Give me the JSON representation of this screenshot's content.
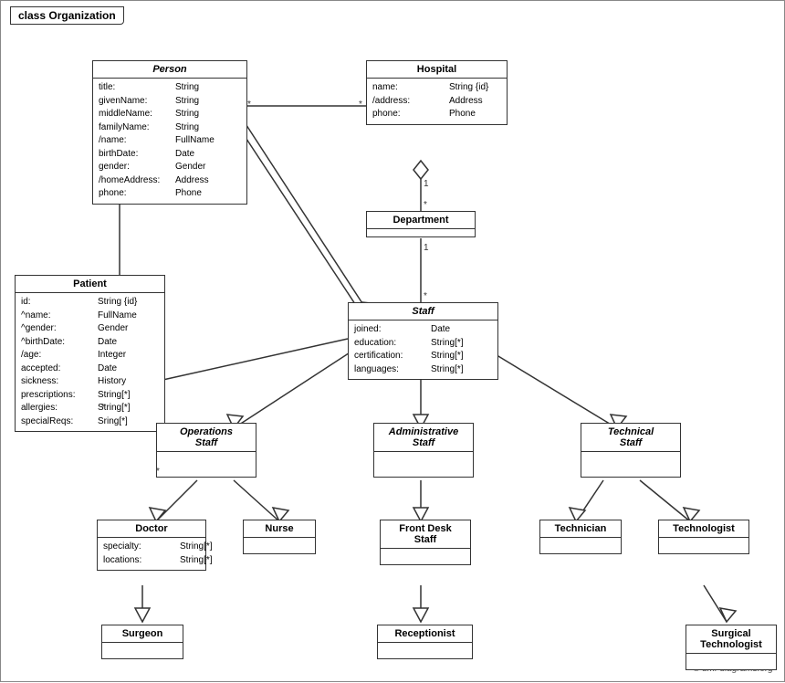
{
  "diagram": {
    "title": "class Organization",
    "copyright": "© uml-diagrams.org",
    "classes": {
      "person": {
        "name": "Person",
        "italic": true,
        "attrs": [
          {
            "name": "title:",
            "type": "String"
          },
          {
            "name": "givenName:",
            "type": "String"
          },
          {
            "name": "middleName:",
            "type": "String"
          },
          {
            "name": "familyName:",
            "type": "String"
          },
          {
            "name": "/name:",
            "type": "FullName"
          },
          {
            "name": "birthDate:",
            "type": "Date"
          },
          {
            "name": "gender:",
            "type": "Gender"
          },
          {
            "name": "/homeAddress:",
            "type": "Address"
          },
          {
            "name": "phone:",
            "type": "Phone"
          }
        ]
      },
      "hospital": {
        "name": "Hospital",
        "italic": false,
        "attrs": [
          {
            "name": "name:",
            "type": "String {id}"
          },
          {
            "name": "/address:",
            "type": "Address"
          },
          {
            "name": "phone:",
            "type": "Phone"
          }
        ]
      },
      "patient": {
        "name": "Patient",
        "italic": false,
        "attrs": [
          {
            "name": "id:",
            "type": "String {id}"
          },
          {
            "name": "^name:",
            "type": "FullName"
          },
          {
            "name": "^gender:",
            "type": "Gender"
          },
          {
            "name": "^birthDate:",
            "type": "Date"
          },
          {
            "name": "/age:",
            "type": "Integer"
          },
          {
            "name": "accepted:",
            "type": "Date"
          },
          {
            "name": "sickness:",
            "type": "History"
          },
          {
            "name": "prescriptions:",
            "type": "String[*]"
          },
          {
            "name": "allergies:",
            "type": "String[*]"
          },
          {
            "name": "specialReqs:",
            "type": "Sring[*]"
          }
        ]
      },
      "department": {
        "name": "Department",
        "italic": false,
        "attrs": []
      },
      "staff": {
        "name": "Staff",
        "italic": true,
        "attrs": [
          {
            "name": "joined:",
            "type": "Date"
          },
          {
            "name": "education:",
            "type": "String[*]"
          },
          {
            "name": "certification:",
            "type": "String[*]"
          },
          {
            "name": "languages:",
            "type": "String[*]"
          }
        ]
      },
      "operations_staff": {
        "name": "Operations Staff",
        "italic": true
      },
      "administrative_staff": {
        "name": "Administrative Staff",
        "italic": true
      },
      "technical_staff": {
        "name": "Technical Staff",
        "italic": true
      },
      "doctor": {
        "name": "Doctor",
        "italic": false,
        "attrs": [
          {
            "name": "specialty:",
            "type": "String[*]"
          },
          {
            "name": "locations:",
            "type": "String[*]"
          }
        ]
      },
      "nurse": {
        "name": "Nurse",
        "italic": false,
        "attrs": []
      },
      "front_desk_staff": {
        "name": "Front Desk Staff",
        "italic": false,
        "attrs": []
      },
      "technician": {
        "name": "Technician",
        "italic": false,
        "attrs": []
      },
      "technologist": {
        "name": "Technologist",
        "italic": false,
        "attrs": []
      },
      "surgeon": {
        "name": "Surgeon",
        "italic": false,
        "attrs": []
      },
      "receptionist": {
        "name": "Receptionist",
        "italic": false,
        "attrs": []
      },
      "surgical_technologist": {
        "name": "Surgical Technologist",
        "italic": false,
        "attrs": []
      }
    }
  }
}
